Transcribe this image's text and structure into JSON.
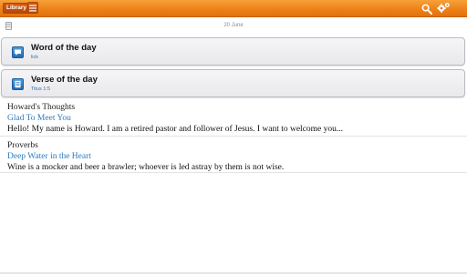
{
  "toolbar": {
    "library_label": "Library",
    "accent_color": "#ee8219",
    "icons": [
      "list-icon",
      "search-icon",
      "settings-icon"
    ]
  },
  "date": {
    "text": "20 June",
    "icon": "calendar-icon"
  },
  "cards": [
    {
      "title": "Word of the day",
      "subtitle": "lick",
      "icon": "speech-bubble-icon"
    },
    {
      "title": "Verse of the day",
      "subtitle": "Titus 1:5",
      "icon": "book-icon"
    }
  ],
  "entries": [
    {
      "source": "Howard's Thoughts",
      "title": "Glad To Meet You",
      "text": "Hello!  My name is Howard. I am a retired pastor and follower of Jesus.  I want to welcome you..."
    },
    {
      "source": "Proverbs",
      "title": "Deep Water in the Heart",
      "text": "Wine is a mocker and beer a brawler; whoever is led astray by them is not wise."
    }
  ]
}
